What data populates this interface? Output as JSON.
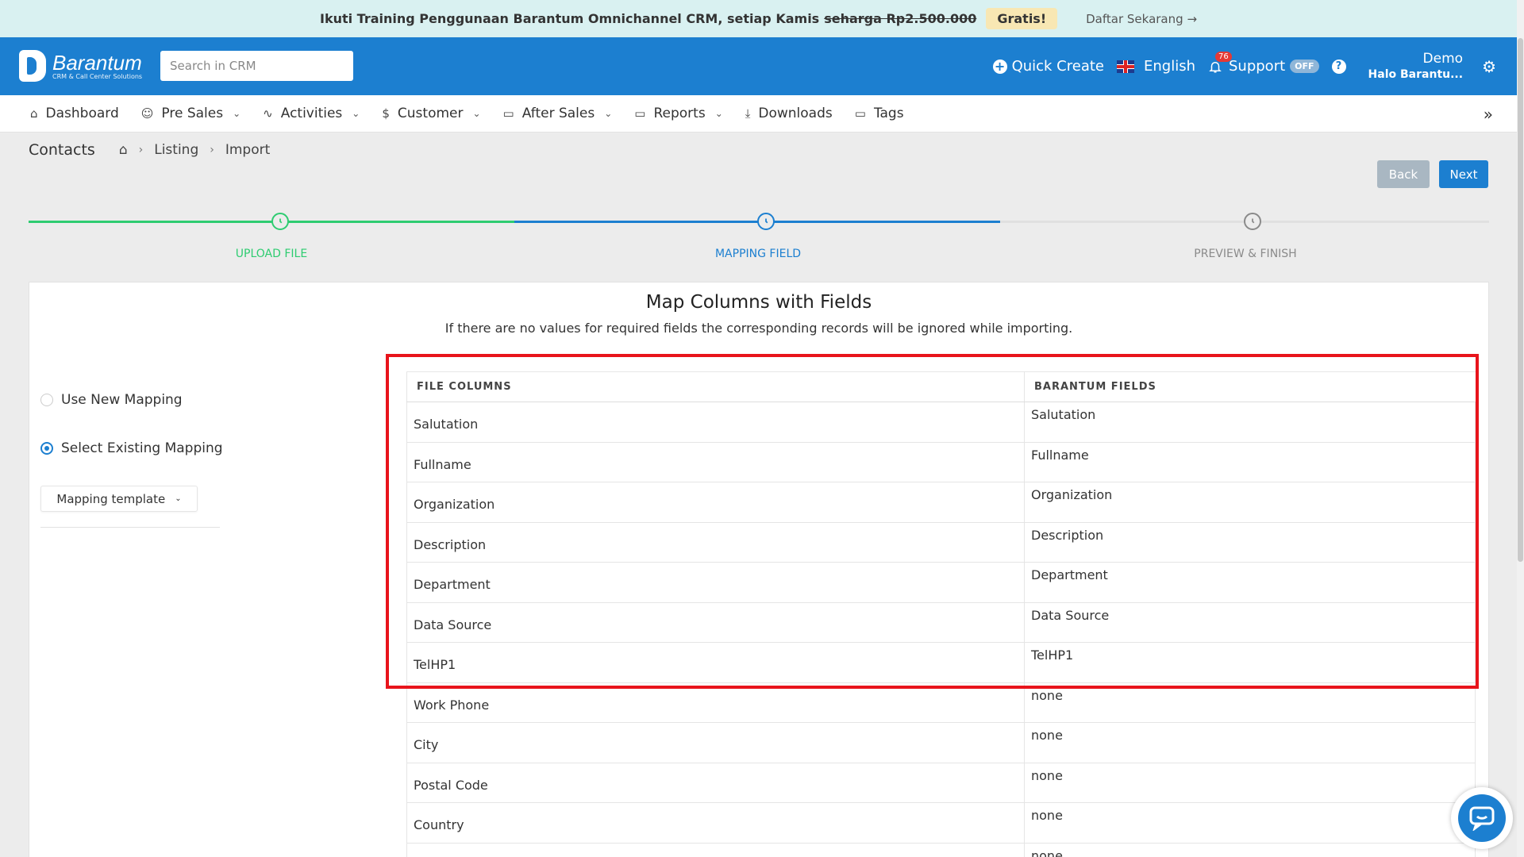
{
  "promo": {
    "message": "Ikuti Training Penggunaan Barantum Omnichannel CRM, setiap Kamis",
    "strike": "seharga Rp2.500.000",
    "badge": "Gratis!",
    "cta": "Daftar Sekarang"
  },
  "header": {
    "brand": "Barantum",
    "tagline": "CRM & Call Center Solutions",
    "search_placeholder": "Search in CRM",
    "quick_create": "Quick Create",
    "language": "English",
    "notifications": "76",
    "support": "Support",
    "support_toggle": "OFF",
    "user_name": "Demo",
    "user_greeting": "Halo Barantu..."
  },
  "nav": {
    "items": [
      {
        "label": "Dashboard",
        "icon": "home-icon"
      },
      {
        "label": "Pre Sales",
        "icon": "users-icon"
      },
      {
        "label": "Activities",
        "icon": "activity-icon"
      },
      {
        "label": "Customer",
        "icon": "dollar-icon"
      },
      {
        "label": "After Sales",
        "icon": "folder-icon"
      },
      {
        "label": "Reports",
        "icon": "folder-icon"
      },
      {
        "label": "Downloads",
        "icon": "download-icon"
      },
      {
        "label": "Tags",
        "icon": "folder-icon"
      }
    ]
  },
  "breadcrumb": {
    "title": "Contacts",
    "listing": "Listing",
    "import": "Import"
  },
  "actions": {
    "back": "Back",
    "next": "Next"
  },
  "steps": [
    {
      "label": "UPLOAD FILE",
      "state": "done",
      "color": "#2ecc71"
    },
    {
      "label": "MAPPING FIELD",
      "state": "active",
      "color": "#1c7fd0"
    },
    {
      "label": "PREVIEW & FINISH",
      "state": "pending",
      "color": "#8a8a8a"
    }
  ],
  "mapping": {
    "title": "Map Columns with Fields",
    "subtitle": "If there are no values for required fields the corresponding records will be ignored while importing.",
    "options": {
      "new": "Use New Mapping",
      "existing": "Select Existing Mapping"
    },
    "template_label": "Mapping template",
    "columns": {
      "file": "FILE COLUMNS",
      "fields": "BARANTUM FIELDS"
    },
    "rows": [
      {
        "file": "Salutation",
        "field": "Salutation"
      },
      {
        "file": "Fullname",
        "field": "Fullname"
      },
      {
        "file": "Organization",
        "field": "Organization"
      },
      {
        "file": "Description",
        "field": "Description"
      },
      {
        "file": "Department",
        "field": "Department"
      },
      {
        "file": "Data Source",
        "field": "Data Source"
      },
      {
        "file": "TelHP1",
        "field": "TelHP1"
      },
      {
        "file": "Work Phone",
        "field": "none"
      },
      {
        "file": "City",
        "field": "none"
      },
      {
        "file": "Postal Code",
        "field": "none"
      },
      {
        "file": "Country",
        "field": "none"
      },
      {
        "file": "",
        "field": "none"
      }
    ]
  },
  "colors": {
    "primary": "#1c7fd0",
    "success": "#2ecc71",
    "highlight": "#e8141b"
  }
}
